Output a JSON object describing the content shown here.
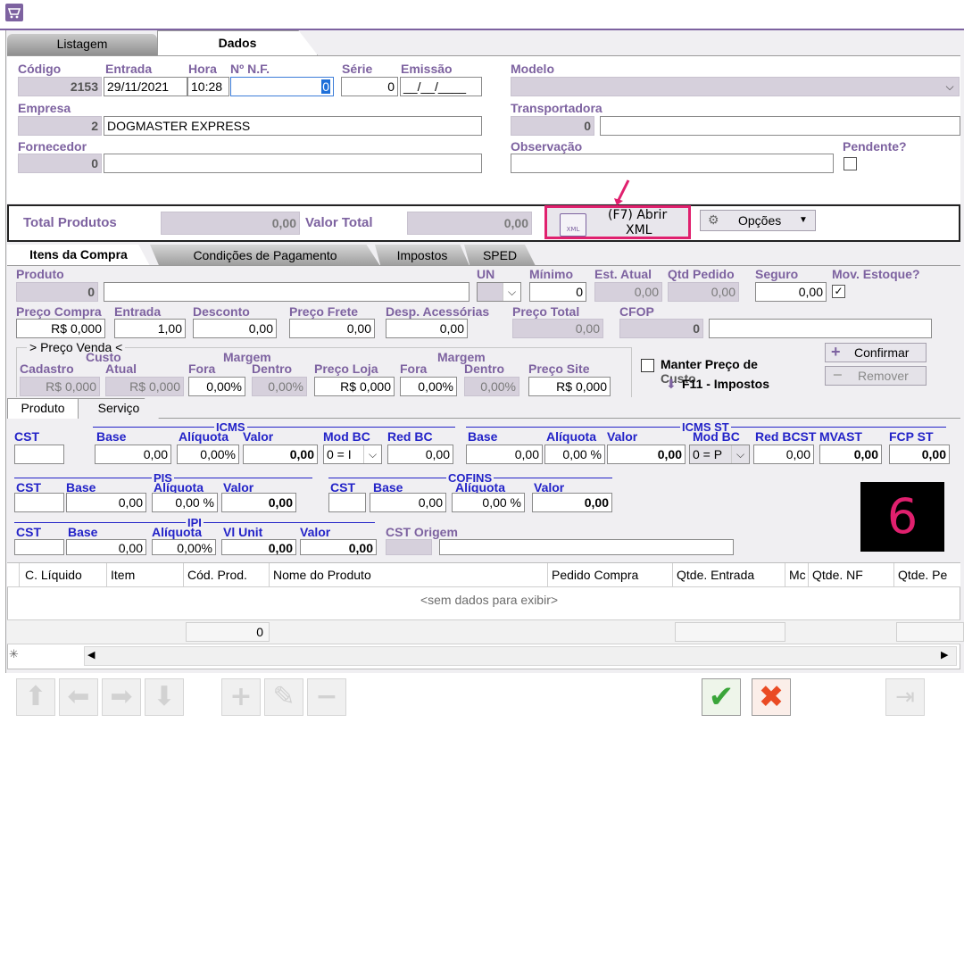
{
  "tabs": {
    "listagem": "Listagem",
    "dados": "Dados"
  },
  "header": {
    "codigo_label": "Código",
    "codigo_value": "2153",
    "entrada_label": "Entrada",
    "entrada_value": "29/11/2021",
    "hora_label": "Hora",
    "hora_value": "10:28",
    "nf_label": "Nº N.F.",
    "nf_value": "0",
    "serie_label": "Série",
    "serie_value": "0",
    "emissao_label": "Emissão",
    "emissao_value": "__/__/____",
    "modelo_label": "Modelo",
    "empresa_label": "Empresa",
    "empresa_code": "2",
    "empresa_name": "DOGMASTER EXPRESS",
    "transportadora_label": "Transportadora",
    "transportadora_code": "0",
    "fornecedor_label": "Fornecedor",
    "fornecedor_code": "0",
    "observacao_label": "Observação",
    "pendente_label": "Pendente?"
  },
  "totals": {
    "total_produtos_label": "Total Produtos",
    "total_produtos_value": "0,00",
    "valor_total_label": "Valor Total",
    "valor_total_value": "0,00",
    "abrir_xml_label_1": "(F7) Abrir",
    "abrir_xml_label_2": "XML",
    "xml_icon_text": "XML",
    "opcoes_label": "Opções"
  },
  "item_tabs": [
    "Itens da Compra",
    "Condições de Pagamento",
    "Impostos",
    "SPED"
  ],
  "item": {
    "produto_label": "Produto",
    "produto_code": "0",
    "un_label": "UN",
    "minimo_label": "Mínimo",
    "minimo_value": "0",
    "est_atual_label": "Est. Atual",
    "est_atual_value": "0,00",
    "qtd_pedido_label": "Qtd Pedido",
    "qtd_pedido_value": "0,00",
    "seguro_label": "Seguro",
    "seguro_value": "0,00",
    "mov_estoque_label": "Mov. Estoque?",
    "preco_compra_label": "Preço Compra",
    "preco_compra_value": "R$ 0,000",
    "entrada_label": "Entrada",
    "entrada_value": "1,00",
    "desconto_label": "Desconto",
    "desconto_value": "0,00",
    "preco_frete_label": "Preço Frete",
    "preco_frete_value": "0,00",
    "desp_acessorias_label": "Desp. Acessórias",
    "desp_acessorias_value": "0,00",
    "preco_total_label": "Preço Total",
    "preco_total_value": "0,00",
    "cfop_label": "CFOP",
    "cfop_value": "0",
    "preco_venda_title": "> Preço Venda <",
    "custo_label": "Custo",
    "cadastro_label": "Cadastro",
    "atual_label": "Atual",
    "cadastro_value": "R$ 0,000",
    "atual_value": "R$ 0,000",
    "margem_label": "Margem",
    "fora_label": "Fora",
    "dentro_label": "Dentro",
    "fora_value": "0,00%",
    "dentro_value": "0,00%",
    "preco_loja_label": "Preço Loja",
    "preco_loja_value": "R$ 0,000",
    "margem2_label": "Margem",
    "fora2_label": "Fora",
    "dentro2_label": "Dentro",
    "fora2_value": "0,00%",
    "dentro2_value": "0,00%",
    "preco_site_label": "Preço Site",
    "preco_site_value": "R$ 0,000",
    "manter_preco_label": "Manter Preço de",
    "manter_preco_label2": "Custo",
    "f11_label": "F11 - Impostos",
    "confirmar_label": "Confirmar",
    "remover_label": "Remover"
  },
  "sub_tabs": [
    "Produto",
    "Serviço"
  ],
  "icms": {
    "title": "ICMS",
    "cst": "CST",
    "base": "Base",
    "aliquota": "Alíquota",
    "valor": "Valor",
    "mod_bc": "Mod BC",
    "red_bc": "Red BC",
    "base_value": "0,00",
    "aliquota_value": "0,00%",
    "valor_value": "0,00",
    "mod_bc_value": "0 = I",
    "red_bc_value": "0,00"
  },
  "icms_st": {
    "title": "ICMS ST",
    "base": "Base",
    "aliquota": "Alíquota",
    "valor": "Valor",
    "mod_bc": "Mod BC",
    "red_bcst": "Red BCST",
    "mvast": "MVAST",
    "fcp_st": "FCP ST",
    "base_value": "0,00",
    "aliquota_value": "0,00 %",
    "valor_value": "0,00",
    "mod_bc_value": "0 = P",
    "red_bcst_value": "0,00",
    "mvast_value": "0,00",
    "fcp_st_value": "0,00"
  },
  "pis": {
    "title": "PIS",
    "cst": "CST",
    "base": "Base",
    "aliquota": "Alíquota",
    "valor": "Valor",
    "base_value": "0,00",
    "aliquota_value": "0,00 %",
    "valor_value": "0,00"
  },
  "cofins": {
    "title": "COFINS",
    "cst": "CST",
    "base": "Base",
    "aliquota": "Alíquota",
    "valor": "Valor",
    "base_value": "0,00",
    "aliquota_value": "0,00 %",
    "valor_value": "0,00"
  },
  "ipi": {
    "title": "IPI",
    "cst": "CST",
    "base": "Base",
    "aliquota": "Alíquota",
    "vl_unit": "Vl Unit",
    "valor": "Valor",
    "cst_origem": "CST Origem",
    "base_value": "0,00",
    "aliquota_value": "0,00%",
    "vl_unit_value": "0,00",
    "valor_value": "0,00"
  },
  "grid": {
    "columns": [
      "C. Líquido",
      "Item",
      "Cód. Prod.",
      "Nome do Produto",
      "Pedido Compra",
      "Qtde. Entrada",
      "Mc",
      "Qtde. NF",
      "Qtde. Pe"
    ],
    "empty_text": "<sem dados para exibir>",
    "footer_count": "0"
  },
  "overlay": {
    "step_number": "6"
  },
  "colors": {
    "label": "#7d62a0",
    "section": "#2323c8",
    "highlight": "#e0206e",
    "readonly_bg": "#d6d0dc"
  }
}
